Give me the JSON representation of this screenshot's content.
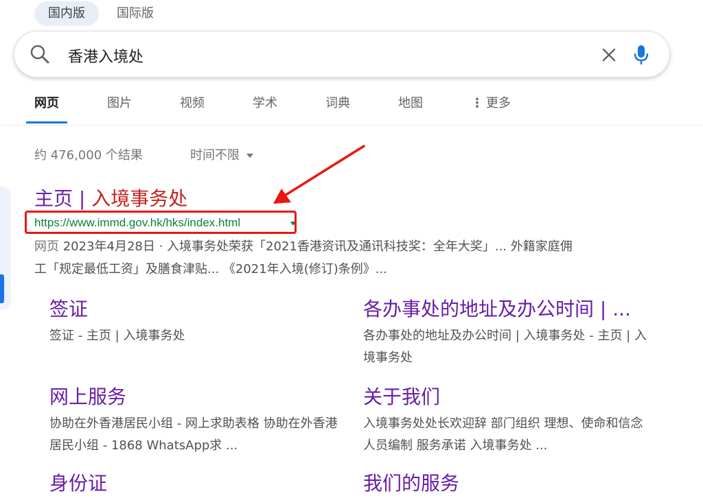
{
  "region_tabs": [
    "国内版",
    "国际版"
  ],
  "search": {
    "query": "香港入境处"
  },
  "nav": {
    "items": [
      "网页",
      "图片",
      "视频",
      "学术",
      "词典",
      "地图",
      "更多"
    ],
    "more_dots": "⋮"
  },
  "results": {
    "stats": "约 476,000 个结果",
    "time_filter": "时间不限"
  },
  "result": {
    "title_prefix": "主页 | ",
    "title_main": "入境事务处",
    "url": "https://www.immd.gov.hk/hks/index.html",
    "snippet_label": "网页",
    "snippet_line1": " 2023年4月28日 · 入境事务处荣获「2021香港资讯及通讯科技奖：全年大奖」... 外籍家庭佣",
    "snippet_line2": "工「规定最低工资」及膳食津贴... 《2021年入境(修订)条例》..."
  },
  "sitelinks": [
    {
      "title": "签证",
      "desc": "签证 - 主页 | 入境事务处"
    },
    {
      "title": "各办事处的地址及办公时间 | ...",
      "desc": "各办事处的地址及办公时间 | 入境事务处 - 主页 | 入境事务处"
    },
    {
      "title": "网上服务",
      "desc": "协助在外香港居民小组 - 网上求助表格 协助在外香港居民小组 - 1868 WhatsApp求 ..."
    },
    {
      "title": "关于我们",
      "desc": "入境事务处处长欢迎辞 部门组织 理想、使命和信念 人员编制 服务承诺 入境事务处 ..."
    },
    {
      "title": "身份证",
      "desc": ""
    },
    {
      "title": "我们的服务",
      "desc": ""
    }
  ],
  "colors": {
    "accent": "#1a73e8",
    "visited_link": "#681da8",
    "url_green": "#0b8043",
    "annotation_red": "#e8170f"
  }
}
